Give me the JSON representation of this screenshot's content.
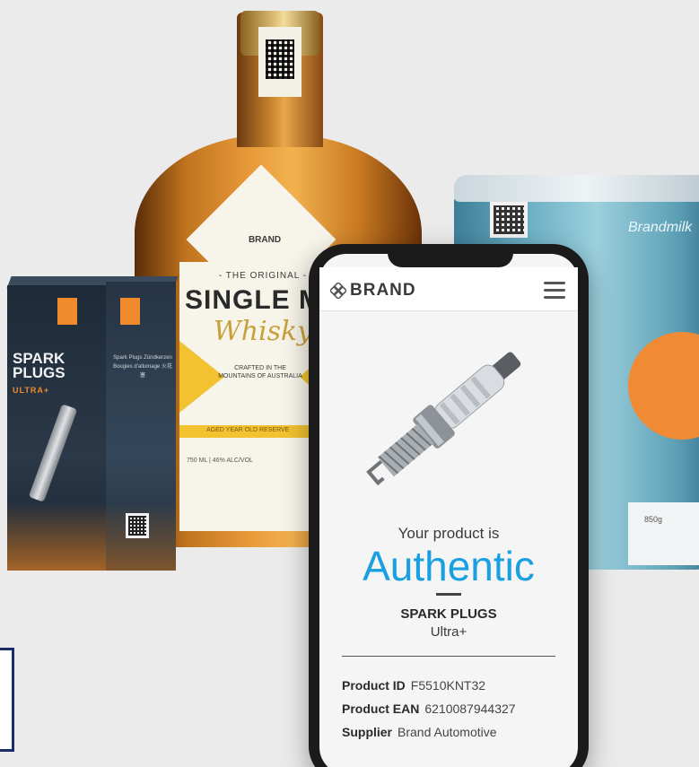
{
  "whisky": {
    "brand": "BRAND",
    "the_original": "- THE ORIGINAL -",
    "single_malt": "SINGLE MA",
    "whisky_script": "Whisky",
    "crafted": "CRAFTED IN THE MOUNTAINS OF AUSTRALIA",
    "band_text": "AGED YEAR OLD RESERVE",
    "volume": "750 ML | 46% ALC/VOL"
  },
  "can": {
    "brand": "Brandmilk",
    "weight": "850g"
  },
  "spark_box": {
    "title_line1": "SPARK",
    "title_line2": "PLUGS",
    "ultra": "ULTRA+",
    "side_text": "Spark Plugs Zündkerzen Bougies d'allumage 火花塞"
  },
  "app": {
    "brand_name": "BRAND",
    "your_product_is": "Your product is",
    "status": "Authentic",
    "product_name": "SPARK PLUGS",
    "product_variant": "Ultra+",
    "details": [
      {
        "label": "Product ID",
        "value": "F5510KNT32"
      },
      {
        "label": "Product EAN",
        "value": "6210087944327"
      },
      {
        "label": "Supplier",
        "value": "Brand Automotive"
      }
    ]
  },
  "colors": {
    "accent_blue": "#1a9fe0",
    "brand_orange": "#f08a2c",
    "background": "#ebebeb"
  }
}
